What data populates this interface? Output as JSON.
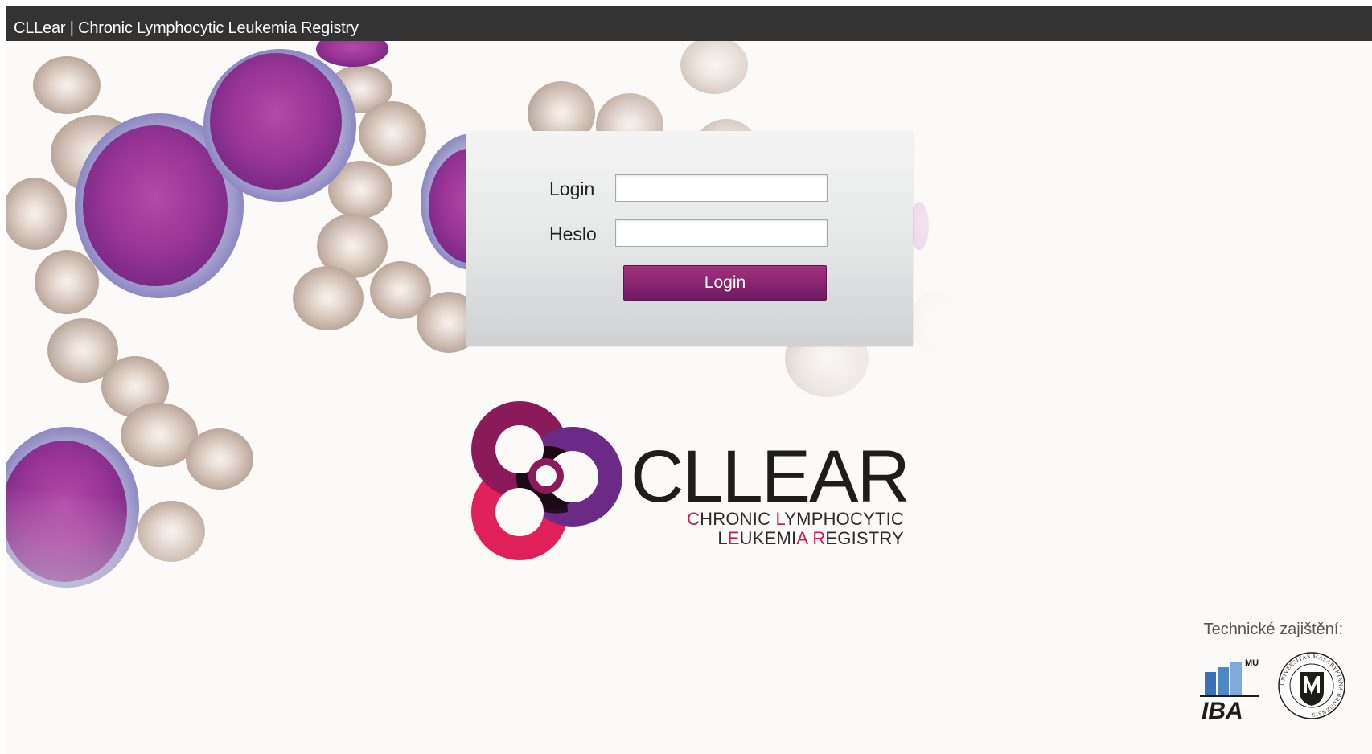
{
  "window": {
    "title": "CLLear | Chronic Lymphocytic Leukemia Registry"
  },
  "login_form": {
    "login_label": "Login",
    "password_label": "Heslo",
    "login_value": "",
    "password_value": "",
    "submit_label": "Login"
  },
  "logo": {
    "wordmark": "CLLEAR",
    "subtitle_line1": "CHRONIC LYMPHOCYTIC",
    "subtitle_line2": "LEUKEMIA REGISTRY",
    "highlight_color": "#c41f4d",
    "ring_colors": [
      "#8b1a5a",
      "#e0205a",
      "#6a2a86",
      "#1b0a16"
    ]
  },
  "footer": {
    "technical_label": "Technické zajištění:",
    "iba_logo_text": "IBA",
    "iba_logo_badge": "MU",
    "mu_seal_text": "UNIVERSITAS MASARYKIANA BRUNENSIS"
  },
  "colors": {
    "title_bar": "#333333",
    "button": "#8a2570",
    "panel": "#e5e6e6"
  }
}
